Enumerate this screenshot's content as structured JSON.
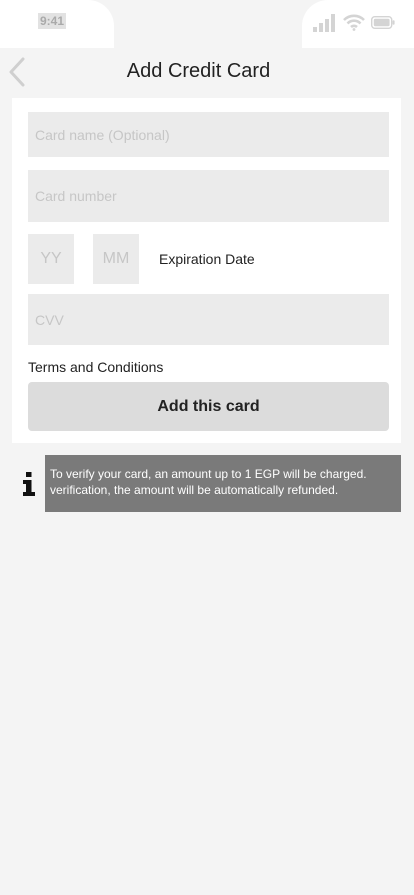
{
  "status_bar": {
    "time": "9:41"
  },
  "header": {
    "title": "Add Credit Card",
    "back_icon": "chevron-left-icon"
  },
  "form": {
    "card_name": {
      "value": "",
      "placeholder": "Card name (Optional)"
    },
    "card_number": {
      "value": "",
      "placeholder": "Card number"
    },
    "year": {
      "value": "",
      "placeholder": "YY"
    },
    "month": {
      "value": "",
      "placeholder": "MM"
    },
    "expiration_label": "Expiration Date",
    "cvv": {
      "value": "",
      "placeholder": "CVV"
    },
    "terms_label": "Terms and Conditions",
    "submit_label": "Add this card"
  },
  "info": {
    "icon": "info-icon",
    "line1": "To verify your card, an amount up to 1 EGP will be charged.",
    "line2": "verification, the amount will be automatically refunded."
  },
  "colors": {
    "background": "#f4f4f4",
    "input_fill": "#ebebeb",
    "button_fill": "#dcdcdc",
    "info_banner": "#7a7a7a"
  }
}
